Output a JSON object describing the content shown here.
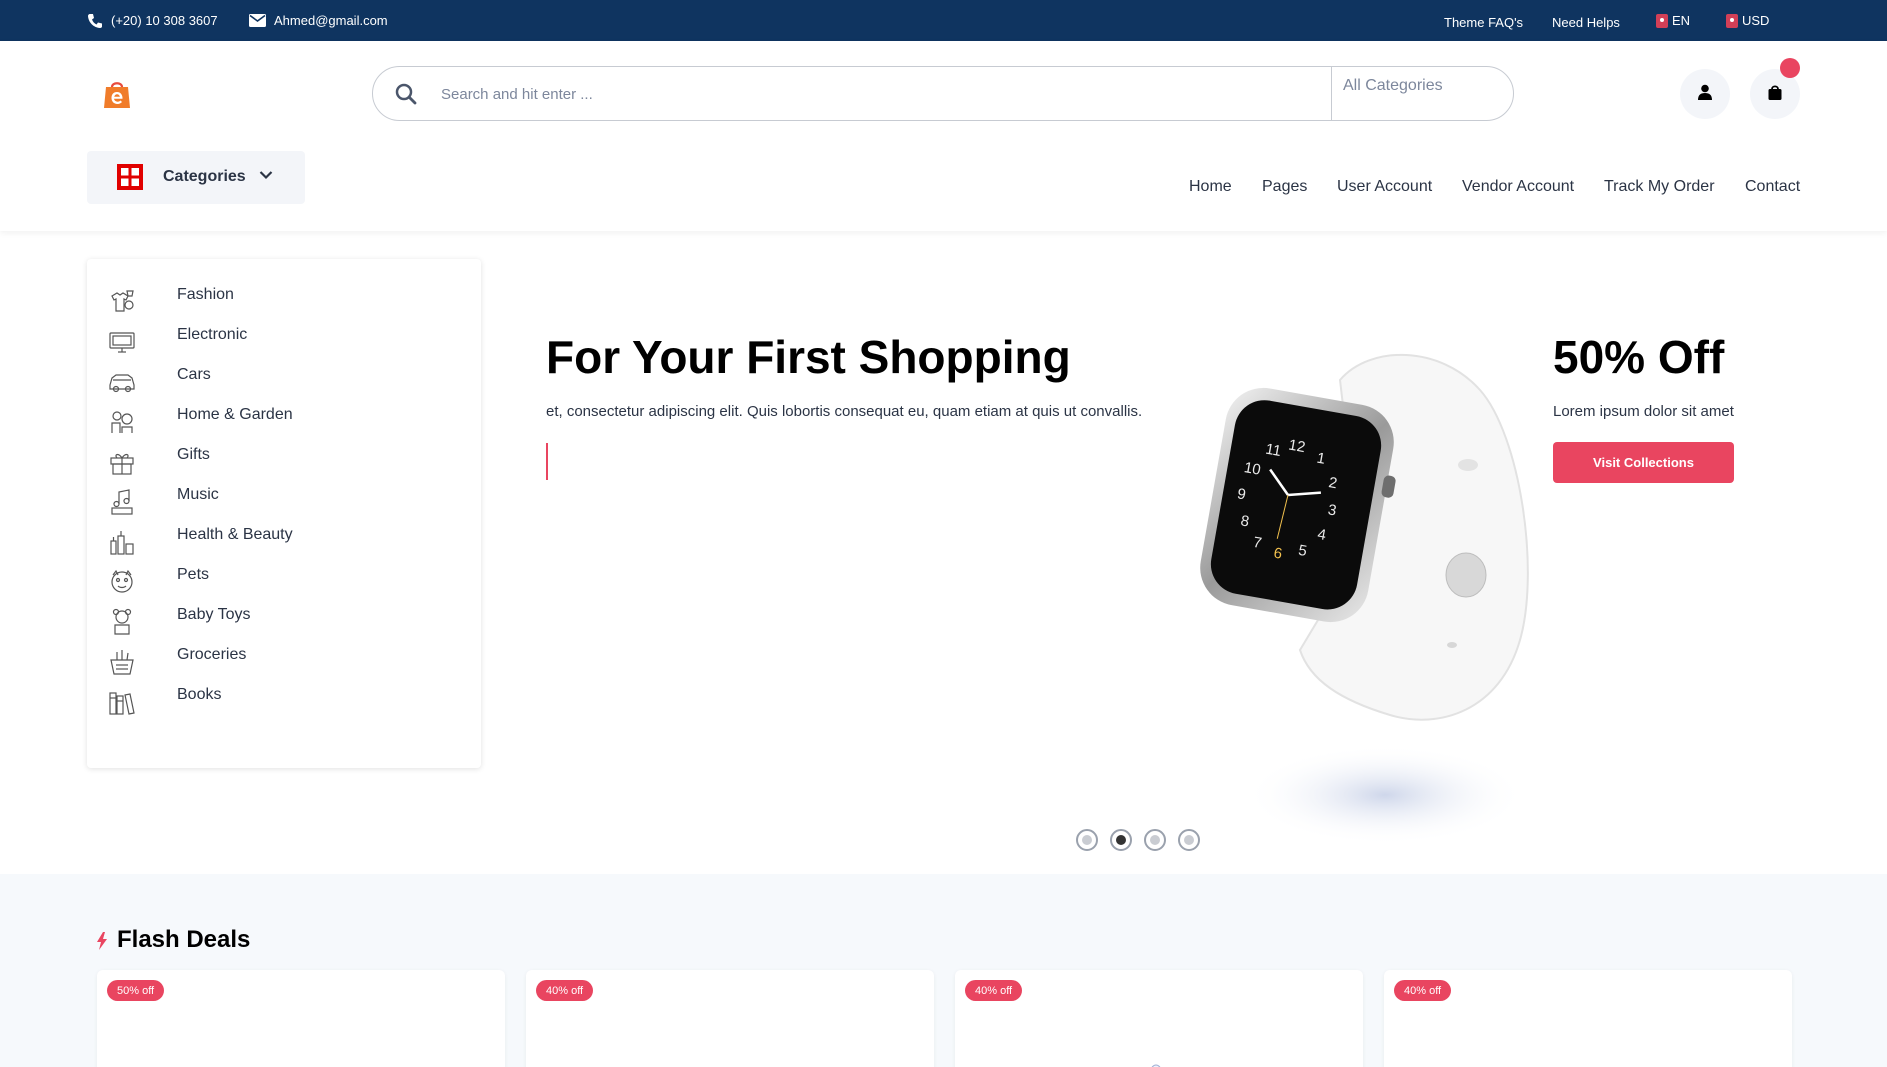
{
  "topbar": {
    "phone": "(+20) 10 308 3607",
    "email": "Ahmed@gmail.com",
    "links": [
      "Theme FAQ's",
      "Need Helps"
    ],
    "language": "EN",
    "currency": "USD"
  },
  "header": {
    "search_placeholder": "Search and hit enter ...",
    "category_select": "All Categories",
    "categories_button": "Categories",
    "nav": [
      "Home",
      "Pages",
      "User Account",
      "Vendor Account",
      "Track My Order",
      "Contact"
    ]
  },
  "sidebar": {
    "items": [
      {
        "label": "Fashion",
        "icon": "fashion-icon"
      },
      {
        "label": "Electronic",
        "icon": "electronic-icon"
      },
      {
        "label": "Cars",
        "icon": "car-icon"
      },
      {
        "label": "Home & Garden",
        "icon": "home-garden-icon"
      },
      {
        "label": "Gifts",
        "icon": "gift-icon"
      },
      {
        "label": "Music",
        "icon": "music-icon"
      },
      {
        "label": "Health & Beauty",
        "icon": "health-beauty-icon"
      },
      {
        "label": "Pets",
        "icon": "pets-icon"
      },
      {
        "label": "Baby Toys",
        "icon": "baby-toys-icon"
      },
      {
        "label": "Groceries",
        "icon": "groceries-icon"
      },
      {
        "label": "Books",
        "icon": "books-icon"
      }
    ]
  },
  "hero": {
    "title": "For Your First Shopping",
    "description": "et, consectetur adipiscing elit. Quis lobortis consequat eu, quam etiam at quis ut convallis.",
    "next_title": "50% Off",
    "next_description": "Lorem ipsum dolor sit amet",
    "button": "Visit Collections",
    "slide_count": 4,
    "active_slide": 2
  },
  "flash_deals": {
    "title": "Flash Deals",
    "badges": [
      "50% off",
      "40% off",
      "40% off",
      "40% off"
    ]
  },
  "colors": {
    "topbar": "#0f3460",
    "accent": "#e94560",
    "text": "#2b3445",
    "section_bg": "#f6f9fc"
  }
}
